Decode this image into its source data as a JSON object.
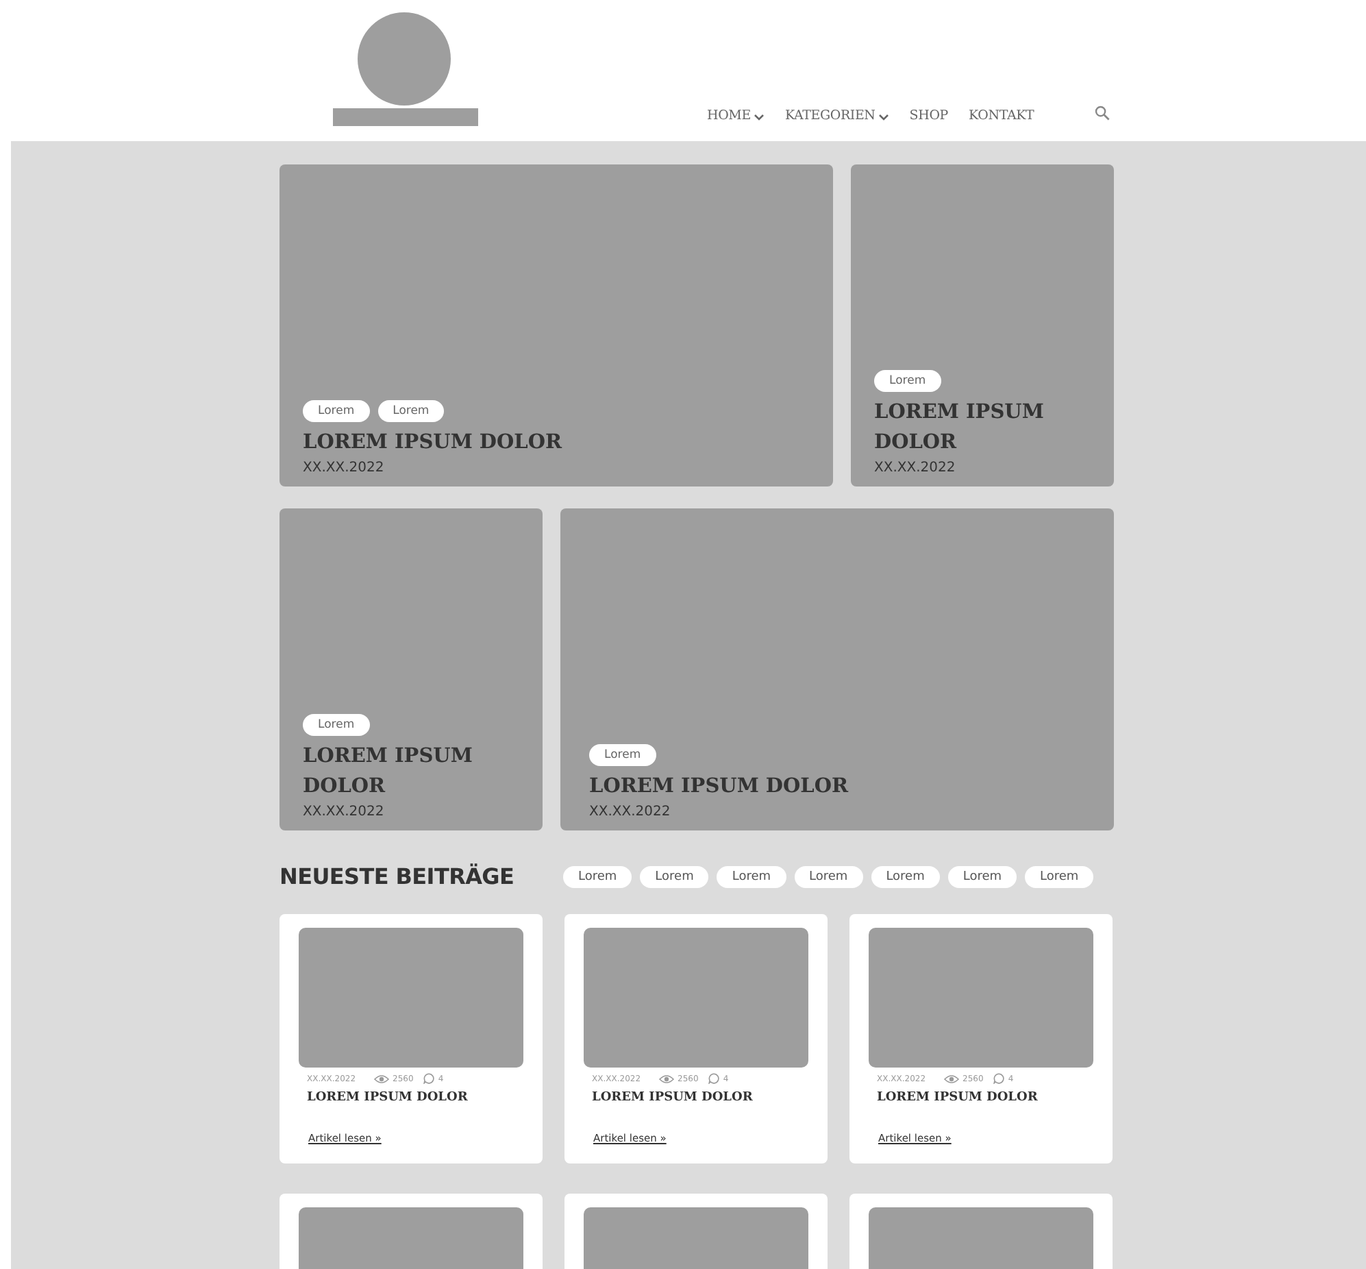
{
  "nav": [
    {
      "label": "HOME",
      "dropdown": true
    },
    {
      "label": "KATEGORIEN",
      "dropdown": true
    },
    {
      "label": "SHOP",
      "dropdown": false
    },
    {
      "label": "KONTAKT",
      "dropdown": false
    }
  ],
  "features": [
    {
      "tags": [
        "Lorem",
        "Lorem"
      ],
      "title": "LOREM IPSUM DOLOR",
      "date": "XX.XX.2022"
    },
    {
      "tags": [
        "Lorem"
      ],
      "title": "LOREM IPSUM DOLOR",
      "date": "XX.XX.2022"
    },
    {
      "tags": [
        "Lorem"
      ],
      "title": "LOREM IPSUM DOLOR",
      "date": "XX.XX.2022"
    },
    {
      "tags": [
        "Lorem"
      ],
      "title": "LOREM IPSUM DOLOR",
      "date": "XX.XX.2022"
    }
  ],
  "latest": {
    "heading": "NEUESTE BEITRÄGE",
    "filters": [
      "Lorem",
      "Lorem",
      "Lorem",
      "Lorem",
      "Lorem",
      "Lorem",
      "Lorem"
    ],
    "posts": [
      {
        "date": "XX.XX.2022",
        "views": "2560",
        "comments": "4",
        "title": "LOREM IPSUM DOLOR",
        "link": "Artikel lesen »"
      },
      {
        "date": "XX.XX.2022",
        "views": "2560",
        "comments": "4",
        "title": "LOREM IPSUM DOLOR",
        "link": "Artikel lesen »"
      },
      {
        "date": "XX.XX.2022",
        "views": "2560",
        "comments": "4",
        "title": "LOREM IPSUM DOLOR",
        "link": "Artikel lesen »"
      }
    ]
  }
}
